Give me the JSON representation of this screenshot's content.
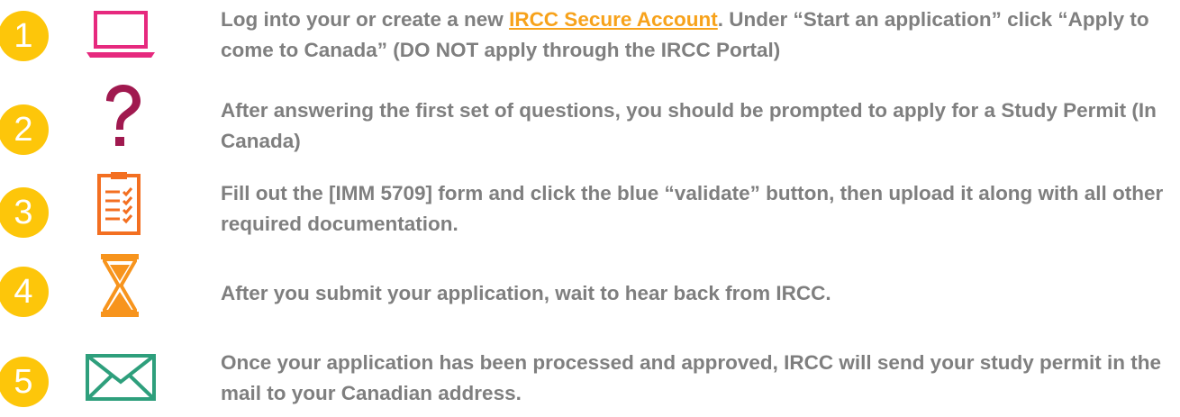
{
  "colors": {
    "circle": "#fdc60a",
    "text": "#7f7f7f",
    "link": "#f7a21b",
    "laptop": "#e6297e",
    "question": "#a0194f",
    "clipboard": "#f36f21",
    "hourglass": "#f7941d",
    "envelope": "#2e9f7c"
  },
  "steps": [
    {
      "number": "1",
      "icon": "laptop-icon",
      "pre": "Log into your or create a new ",
      "link": "IRCC Secure Account",
      "post": ". Under “Start an application” click “Apply to come to Canada” (DO NOT apply through the IRCC Portal)"
    },
    {
      "number": "2",
      "icon": "question-mark-icon",
      "text": "After answering the first set of questions, you should be prompted to apply for a Study Permit (In Canada)"
    },
    {
      "number": "3",
      "icon": "clipboard-checklist-icon",
      "text": "Fill out the [IMM 5709] form and click the blue “validate” button, then upload it along with all other required documentation."
    },
    {
      "number": "4",
      "icon": "hourglass-icon",
      "text": "After you submit your application, wait to hear back from IRCC."
    },
    {
      "number": "5",
      "icon": "envelope-icon",
      "text": "Once your application has been processed and approved, IRCC will send your study permit in the mail to your Canadian address."
    }
  ]
}
